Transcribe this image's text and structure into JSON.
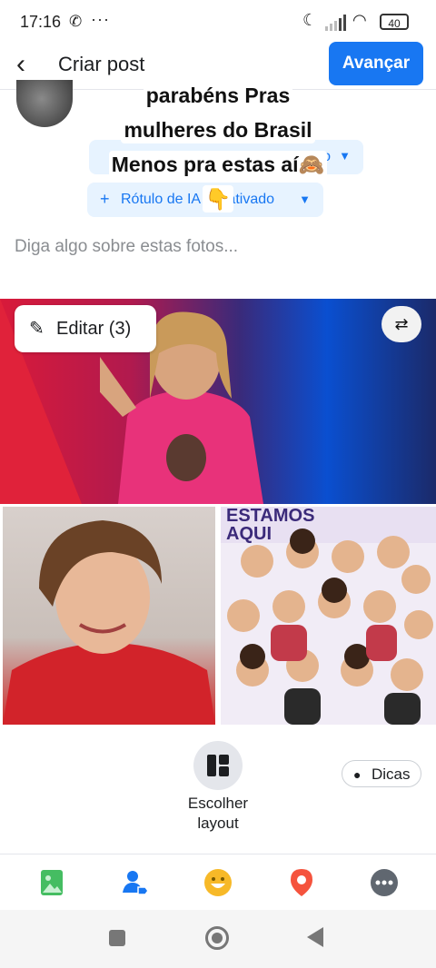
{
  "status_bar": {
    "time": "17:16",
    "whatsapp_icon": "whatsapp-icon",
    "more": "···",
    "battery": "40"
  },
  "header": {
    "title": "Criar post",
    "next_label": "Avançar"
  },
  "caption": {
    "line1": "parabéns Pras",
    "line2": "mulheres do Brasil",
    "line3": "Menos pra estas aí🙈",
    "line4": "👇"
  },
  "audience": {
    "partial_label": "o"
  },
  "label_pill": {
    "plus": "+",
    "text": "Rótulo de IA desativado"
  },
  "compose": {
    "placeholder": "Diga algo sobre estas fotos..."
  },
  "photos": {
    "edit_label": "Editar (3)",
    "poster_text_line1": "ESTAMOS",
    "poster_text_line2": "AQUI"
  },
  "layout": {
    "label_line1": "Escolher",
    "label_line2": "layout"
  },
  "tips": {
    "label": "Dicas"
  },
  "colors": {
    "accent": "#1877f2",
    "photo_icon": "#45bd62",
    "tag_icon": "#1877f2",
    "feeling_icon": "#f7b928",
    "location_icon": "#f5533d",
    "more_icon": "#606770"
  }
}
